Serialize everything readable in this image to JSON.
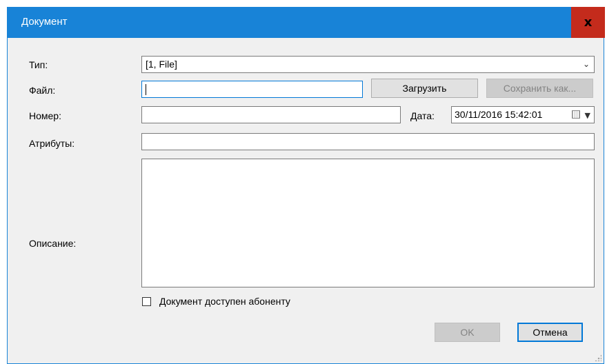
{
  "window": {
    "title": "Документ",
    "close_label": "x"
  },
  "form": {
    "type_label": "Тип:",
    "type_value": "[1, File]",
    "file_label": "Файл:",
    "file_value": "",
    "load_button": "Загрузить",
    "save_as_button": "Сохранить как...",
    "number_label": "Номер:",
    "number_value": "",
    "date_label": "Дата:",
    "date_value": "30/11/2016 15:42:01",
    "attributes_label": "Атрибуты:",
    "attributes_value": "",
    "description_label": "Описание:",
    "description_value": "",
    "checkbox_label": "Документ доступен абоненту",
    "checkbox_checked": false
  },
  "buttons": {
    "ok": "OK",
    "cancel": "Отмена"
  },
  "colors": {
    "titlebar": "#1883d7",
    "close": "#c42b1c",
    "dialog_bg": "#f0f0f0"
  }
}
